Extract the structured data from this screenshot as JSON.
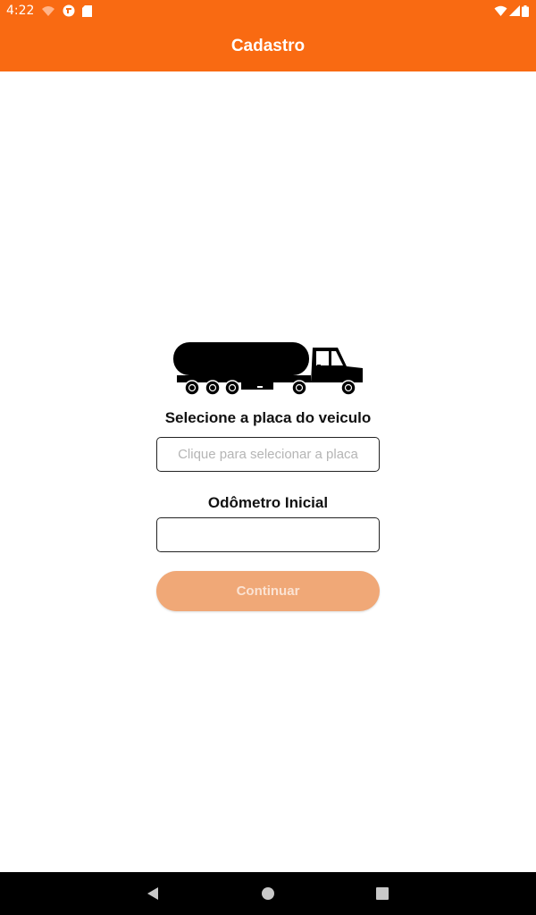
{
  "status_bar": {
    "time": "4:22",
    "left_icons": [
      "cast-icon",
      "vpn-icon",
      "sd-card-icon"
    ],
    "right_icons": [
      "wifi-icon",
      "signal-icon",
      "battery-icon"
    ],
    "background_color": "#f96a12"
  },
  "app_bar": {
    "title": "Cadastro",
    "background_color": "#f96a12"
  },
  "form": {
    "illustration": "tanker-truck-icon",
    "plate_label": "Selecione a placa do veiculo",
    "plate_placeholder": "Clique para selecionar a placa",
    "plate_value": "",
    "odometer_label": "Odômetro Inicial",
    "odometer_placeholder": "",
    "odometer_value": "",
    "continue_label": "Continuar",
    "continue_enabled": false,
    "accent_color": "#f96a12"
  },
  "nav_bar": {
    "buttons": [
      "back-icon",
      "home-icon",
      "recents-icon"
    ]
  }
}
